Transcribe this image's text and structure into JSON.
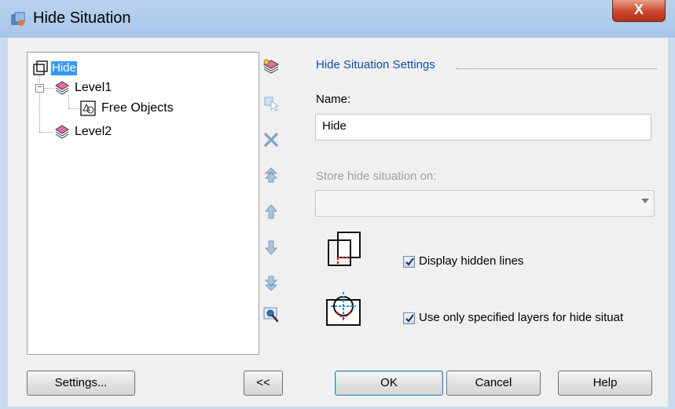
{
  "window": {
    "title": "Hide Situation",
    "close_glyph": "X"
  },
  "tree": {
    "items": [
      {
        "label": "Hide",
        "icon": "situation-icon",
        "selected": true
      },
      {
        "label": "Level1",
        "icon": "layer-icon",
        "expanded": true
      },
      {
        "label": "Free Objects",
        "icon": "free-objects-icon"
      },
      {
        "label": "Level2",
        "icon": "layer-icon"
      }
    ],
    "expander_glyph": "−"
  },
  "toolbar": {
    "buttons": [
      {
        "name": "add-layer-icon",
        "enabled": true
      },
      {
        "name": "select-objects-icon",
        "enabled": false
      },
      {
        "name": "delete-icon",
        "enabled": false
      },
      {
        "name": "move-top-icon",
        "enabled": false
      },
      {
        "name": "move-up-icon",
        "enabled": false
      },
      {
        "name": "move-down-icon",
        "enabled": false
      },
      {
        "name": "move-bottom-icon",
        "enabled": false
      },
      {
        "name": "zoom-to-icon",
        "enabled": true
      }
    ]
  },
  "settings": {
    "section_title": "Hide Situation Settings",
    "name_label": "Name:",
    "name_value": "Hide",
    "store_label": "Store hide situation on:",
    "store_value": "",
    "display_hidden_lines_label": "Display hidden lines",
    "display_hidden_lines_checked": true,
    "use_layers_label": "Use only specified layers for hide situat",
    "use_layers_checked": true
  },
  "buttons": {
    "settings": "Settings...",
    "collapse": "<<",
    "ok": "OK",
    "cancel": "Cancel",
    "help": "Help"
  },
  "colors": {
    "title_bar": "#a7c6e8",
    "selection": "#3399ff",
    "section_title": "#0b4fa8",
    "close_button": "#c8452b"
  }
}
